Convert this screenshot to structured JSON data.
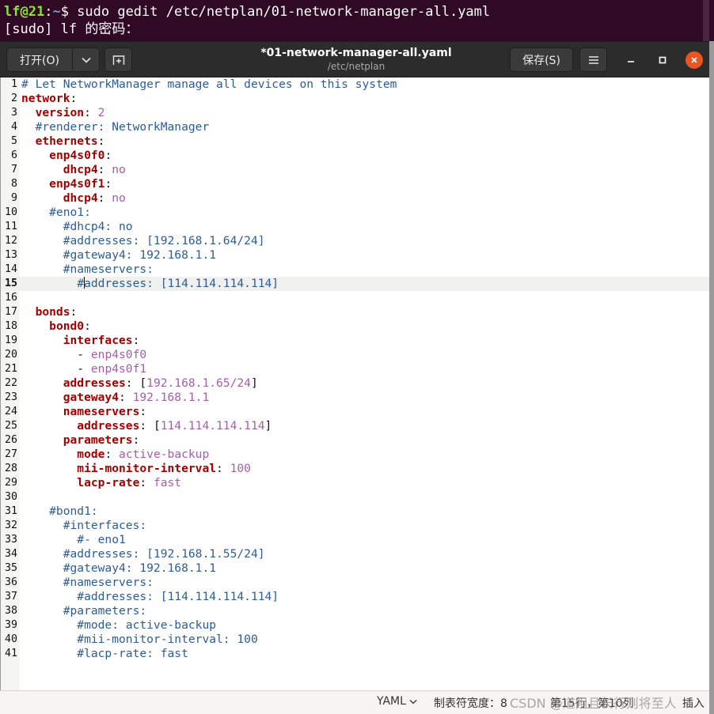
{
  "terminal": {
    "user_host": "lf@21",
    "colon": ":",
    "path": "~",
    "command": "$ sudo gedit /etc/netplan/01-network-manager-all.yaml",
    "sudo_prompt": "[sudo] lf 的密码："
  },
  "header": {
    "open_label": "打开(O)",
    "title": "*01-network-manager-all.yaml",
    "subtitle": "/etc/netplan",
    "save_label": "保存(S)"
  },
  "editor": {
    "current_line": 15,
    "lines": [
      {
        "n": "1",
        "segs": [
          {
            "t": "# Let NetworkManager manage all devices on this system",
            "c": "c"
          }
        ]
      },
      {
        "n": "2",
        "segs": [
          {
            "t": "network",
            "c": "k"
          },
          {
            "t": ":",
            "c": "p"
          }
        ]
      },
      {
        "n": "3",
        "segs": [
          {
            "t": "  ",
            "c": "p"
          },
          {
            "t": "version",
            "c": "k"
          },
          {
            "t": ": ",
            "c": "p"
          },
          {
            "t": "2",
            "c": "v"
          }
        ]
      },
      {
        "n": "4",
        "segs": [
          {
            "t": "  #renderer: NetworkManager",
            "c": "c"
          }
        ]
      },
      {
        "n": "5",
        "segs": [
          {
            "t": "  ",
            "c": "p"
          },
          {
            "t": "ethernets",
            "c": "k"
          },
          {
            "t": ":",
            "c": "p"
          }
        ]
      },
      {
        "n": "6",
        "segs": [
          {
            "t": "    ",
            "c": "p"
          },
          {
            "t": "enp4s0f0",
            "c": "k"
          },
          {
            "t": ":",
            "c": "p"
          }
        ]
      },
      {
        "n": "7",
        "segs": [
          {
            "t": "      ",
            "c": "p"
          },
          {
            "t": "dhcp4",
            "c": "k"
          },
          {
            "t": ": ",
            "c": "p"
          },
          {
            "t": "no",
            "c": "v"
          }
        ]
      },
      {
        "n": "8",
        "segs": [
          {
            "t": "    ",
            "c": "p"
          },
          {
            "t": "enp4s0f1",
            "c": "k"
          },
          {
            "t": ":",
            "c": "p"
          }
        ]
      },
      {
        "n": "9",
        "segs": [
          {
            "t": "      ",
            "c": "p"
          },
          {
            "t": "dhcp4",
            "c": "k"
          },
          {
            "t": ": ",
            "c": "p"
          },
          {
            "t": "no",
            "c": "v"
          }
        ]
      },
      {
        "n": "10",
        "segs": [
          {
            "t": "    #eno1:",
            "c": "c"
          }
        ]
      },
      {
        "n": "11",
        "segs": [
          {
            "t": "      #dhcp4: no",
            "c": "c"
          }
        ]
      },
      {
        "n": "12",
        "segs": [
          {
            "t": "      #addresses: [192.168.1.64/24]",
            "c": "c"
          }
        ]
      },
      {
        "n": "13",
        "segs": [
          {
            "t": "      #gateway4: 192.168.1.1",
            "c": "c"
          }
        ]
      },
      {
        "n": "14",
        "segs": [
          {
            "t": "      #nameservers:",
            "c": "c"
          }
        ]
      },
      {
        "n": "15",
        "segs": [
          {
            "t": "        #",
            "c": "c"
          },
          {
            "t": "",
            "c": "cursor"
          },
          {
            "t": "addresses: [114.114.114.114]",
            "c": "c"
          }
        ]
      },
      {
        "n": "16",
        "segs": []
      },
      {
        "n": "17",
        "segs": [
          {
            "t": "  ",
            "c": "p"
          },
          {
            "t": "bonds",
            "c": "k"
          },
          {
            "t": ":",
            "c": "p"
          }
        ]
      },
      {
        "n": "18",
        "segs": [
          {
            "t": "    ",
            "c": "p"
          },
          {
            "t": "bond0",
            "c": "k"
          },
          {
            "t": ":",
            "c": "p"
          }
        ]
      },
      {
        "n": "19",
        "segs": [
          {
            "t": "      ",
            "c": "p"
          },
          {
            "t": "interfaces",
            "c": "k"
          },
          {
            "t": ":",
            "c": "p"
          }
        ]
      },
      {
        "n": "20",
        "segs": [
          {
            "t": "        - ",
            "c": "p"
          },
          {
            "t": "enp4s0f0",
            "c": "v"
          }
        ]
      },
      {
        "n": "21",
        "segs": [
          {
            "t": "        - ",
            "c": "p"
          },
          {
            "t": "enp4s0f1",
            "c": "v"
          }
        ]
      },
      {
        "n": "22",
        "segs": [
          {
            "t": "      ",
            "c": "p"
          },
          {
            "t": "addresses",
            "c": "k"
          },
          {
            "t": ": [",
            "c": "p"
          },
          {
            "t": "192.168.1.65/24",
            "c": "v"
          },
          {
            "t": "]",
            "c": "p"
          }
        ]
      },
      {
        "n": "23",
        "segs": [
          {
            "t": "      ",
            "c": "p"
          },
          {
            "t": "gateway4",
            "c": "k"
          },
          {
            "t": ": ",
            "c": "p"
          },
          {
            "t": "192.168.1.1",
            "c": "v"
          }
        ]
      },
      {
        "n": "24",
        "segs": [
          {
            "t": "      ",
            "c": "p"
          },
          {
            "t": "nameservers",
            "c": "k"
          },
          {
            "t": ":",
            "c": "p"
          }
        ]
      },
      {
        "n": "25",
        "segs": [
          {
            "t": "        ",
            "c": "p"
          },
          {
            "t": "addresses",
            "c": "k"
          },
          {
            "t": ": [",
            "c": "p"
          },
          {
            "t": "114.114.114.114",
            "c": "v"
          },
          {
            "t": "]",
            "c": "p"
          }
        ]
      },
      {
        "n": "26",
        "segs": [
          {
            "t": "      ",
            "c": "p"
          },
          {
            "t": "parameters",
            "c": "k"
          },
          {
            "t": ":",
            "c": "p"
          }
        ]
      },
      {
        "n": "27",
        "segs": [
          {
            "t": "        ",
            "c": "p"
          },
          {
            "t": "mode",
            "c": "k"
          },
          {
            "t": ": ",
            "c": "p"
          },
          {
            "t": "active-backup",
            "c": "v"
          }
        ]
      },
      {
        "n": "28",
        "segs": [
          {
            "t": "        ",
            "c": "p"
          },
          {
            "t": "mii-monitor-interval",
            "c": "k"
          },
          {
            "t": ": ",
            "c": "p"
          },
          {
            "t": "100",
            "c": "v"
          }
        ]
      },
      {
        "n": "29",
        "segs": [
          {
            "t": "        ",
            "c": "p"
          },
          {
            "t": "lacp-rate",
            "c": "k"
          },
          {
            "t": ": ",
            "c": "p"
          },
          {
            "t": "fast",
            "c": "v"
          }
        ]
      },
      {
        "n": "30",
        "segs": []
      },
      {
        "n": "31",
        "segs": [
          {
            "t": "    #bond1:",
            "c": "c"
          }
        ]
      },
      {
        "n": "32",
        "segs": [
          {
            "t": "      #interfaces:",
            "c": "c"
          }
        ]
      },
      {
        "n": "33",
        "segs": [
          {
            "t": "        #- eno1",
            "c": "c"
          }
        ]
      },
      {
        "n": "34",
        "segs": [
          {
            "t": "      #addresses: [192.168.1.55/24]",
            "c": "c"
          }
        ]
      },
      {
        "n": "35",
        "segs": [
          {
            "t": "      #gateway4: 192.168.1.1",
            "c": "c"
          }
        ]
      },
      {
        "n": "36",
        "segs": [
          {
            "t": "      #nameservers:",
            "c": "c"
          }
        ]
      },
      {
        "n": "37",
        "segs": [
          {
            "t": "        #addresses: [114.114.114.114]",
            "c": "c"
          }
        ]
      },
      {
        "n": "38",
        "segs": [
          {
            "t": "      #parameters:",
            "c": "c"
          }
        ]
      },
      {
        "n": "39",
        "segs": [
          {
            "t": "        #mode: active-backup",
            "c": "c"
          }
        ]
      },
      {
        "n": "40",
        "segs": [
          {
            "t": "        #mii-monitor-interval: 100",
            "c": "c"
          }
        ]
      },
      {
        "n": "41",
        "segs": [
          {
            "t": "        #lacp-rate: fast",
            "c": "c"
          }
        ]
      }
    ]
  },
  "statusbar": {
    "language": "YAML",
    "tab_width": "制表符宽度：8",
    "position": "第15行，第10列",
    "insert_mode": "插入"
  },
  "watermark": "CSDN @道阻且长行则将至人",
  "colors": {
    "terminal_bg": "#300a24",
    "headerbar_bg": "#2c2c2c",
    "close_button": "#e95420",
    "keyword": "#a40000",
    "comment": "#2c5c96",
    "value": "#a45ea8"
  },
  "icons": {
    "open_dropdown": "chevron-down-icon",
    "new_tab": "new-tab-icon",
    "menu": "hamburger-menu-icon",
    "minimize": "minimize-icon",
    "maximize": "maximize-icon",
    "close": "close-icon"
  }
}
